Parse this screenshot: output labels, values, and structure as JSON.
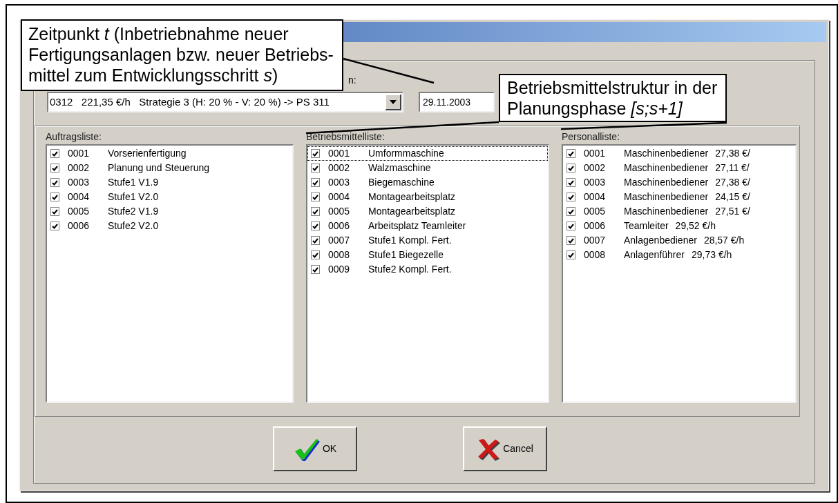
{
  "callouts": [
    {
      "text": "Zeitpunkt *t* (Inbetriebnahme neuer Fertigungsanlagen bzw. neuer Betriebs-mittel zum Entwicklungsschritt *s*)"
    },
    {
      "text": "Betriebsmittelstruktur in der Planungsphase *[s;s+1]*"
    }
  ],
  "combo": {
    "label": "n:",
    "value": "0312   221,35 €/h   Strategie 3 (H: 20 % - V: 20 %) -> PS 311"
  },
  "date_field": {
    "value": "29.11.2003"
  },
  "lists": [
    {
      "label": "Auftragsliste:",
      "items": [
        {
          "code": "0001",
          "name": "Vorserienfertigung",
          "checked": true,
          "focused": false
        },
        {
          "code": "0002",
          "name": "Planung und Steuerung",
          "checked": true,
          "focused": false
        },
        {
          "code": "0003",
          "name": "Stufe1 V1.9",
          "checked": true,
          "focused": false
        },
        {
          "code": "0004",
          "name": "Stufe1 V2.0",
          "checked": true,
          "focused": false
        },
        {
          "code": "0005",
          "name": "Stufe2 V1.9",
          "checked": true,
          "focused": false
        },
        {
          "code": "0006",
          "name": "Stufe2 V2.0",
          "checked": true,
          "focused": false
        }
      ]
    },
    {
      "label": "Betriebsmittelliste:",
      "items": [
        {
          "code": "0001",
          "name": "Umformmaschine",
          "checked": true,
          "focused": true
        },
        {
          "code": "0002",
          "name": "Walzmaschine",
          "checked": true,
          "focused": false
        },
        {
          "code": "0003",
          "name": "Biegemaschine",
          "checked": true,
          "focused": false
        },
        {
          "code": "0004",
          "name": "Montagearbeitsplatz",
          "checked": true,
          "focused": false
        },
        {
          "code": "0005",
          "name": "Montagearbeitsplatz",
          "checked": true,
          "focused": false
        },
        {
          "code": "0006",
          "name": "Arbeitsplatz Teamleiter",
          "checked": true,
          "focused": false
        },
        {
          "code": "0007",
          "name": "Stufe1 Kompl. Fert.",
          "checked": true,
          "focused": false
        },
        {
          "code": "0008",
          "name": "Stufe1 Biegezelle",
          "checked": true,
          "focused": false
        },
        {
          "code": "0009",
          "name": "Stufe2 Kompl. Fert.",
          "checked": true,
          "focused": false
        }
      ]
    },
    {
      "label": "Personalliste:",
      "items": [
        {
          "code": "0001",
          "name": "Maschinenbediener",
          "rate": "27,38 €/",
          "checked": true,
          "focused": false
        },
        {
          "code": "0002",
          "name": "Maschinenbediener",
          "rate": "27,11 €/",
          "checked": true,
          "focused": false
        },
        {
          "code": "0003",
          "name": "Maschinenbediener",
          "rate": "27,38 €/",
          "checked": true,
          "focused": false
        },
        {
          "code": "0004",
          "name": "Maschinenbediener",
          "rate": "24,15 €/",
          "checked": true,
          "focused": false
        },
        {
          "code": "0005",
          "name": "Maschinenbediener",
          "rate": "27,51 €/",
          "checked": true,
          "focused": false
        },
        {
          "code": "0006",
          "name": "Teamleiter",
          "rate": "29,52 €/h",
          "checked": true,
          "focused": false
        },
        {
          "code": "0007",
          "name": "Anlagenbediener",
          "rate": "28,57 €/h",
          "checked": true,
          "focused": false
        },
        {
          "code": "0008",
          "name": "Anlagenführer",
          "rate": "29,73 €/h",
          "checked": true,
          "focused": false
        }
      ]
    }
  ],
  "buttons": [
    {
      "kind": "ok",
      "label": "OK"
    },
    {
      "kind": "cancel",
      "label": "Cancel"
    }
  ]
}
